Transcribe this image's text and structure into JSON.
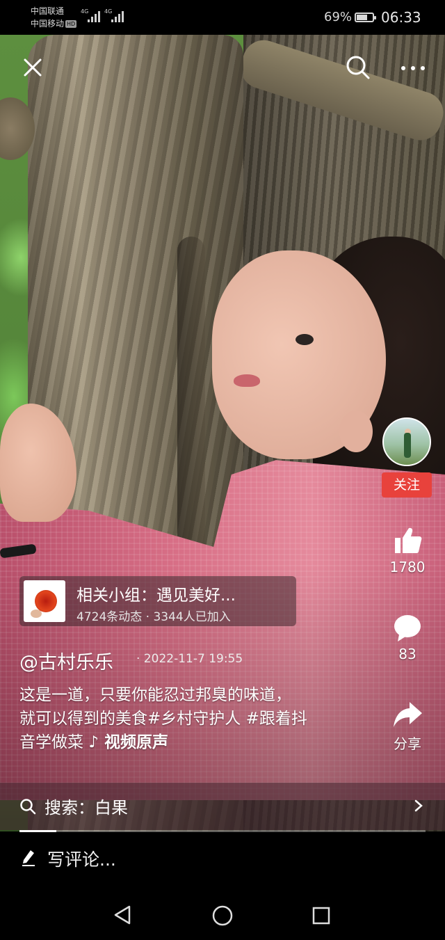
{
  "status_bar": {
    "carrier_1": "中国联通",
    "carrier_2": "中国移动",
    "hd_badge": "HD",
    "network_1": "4G",
    "network_2": "4G",
    "battery_percent": "69%",
    "battery_level": 0.69,
    "time": "06:33"
  },
  "top_bar": {
    "icons": [
      "close-icon",
      "search-icon",
      "more-icon"
    ]
  },
  "side_rail": {
    "follow_label": "关注",
    "likes": "1780",
    "comments": "83",
    "share_label": "分享"
  },
  "group_card": {
    "title": "相关小组：遇见美好...",
    "subtitle": "4724条动态 · 3344人已加入"
  },
  "post": {
    "author": "@古村乐乐",
    "date": "· 2022-11-7 19:55",
    "caption_line1": "这是一道，只要你能忍过邦臭的味道，",
    "caption_line2": "就可以得到的美食#乡村守护人 #跟着抖",
    "caption_line3": "音学做菜",
    "music": "♪ 视频原声"
  },
  "search_bar": {
    "label": "搜索：白果"
  },
  "playback": {
    "progress": 0.09
  },
  "comment_bar": {
    "placeholder": "写评论..."
  },
  "colors": {
    "follow_red": "#e8423c",
    "background": "#000000"
  }
}
